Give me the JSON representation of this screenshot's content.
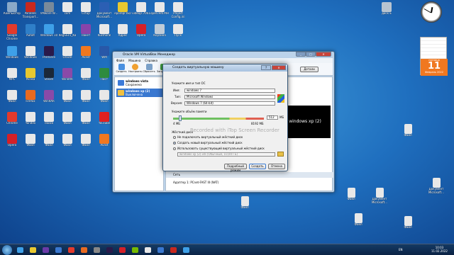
{
  "desktop_icons": [
    {
      "label": "Компьютер",
      "color": "#8aa8c8"
    },
    {
      "label": "Parallels Transport...",
      "color": "#c8281e"
    },
    {
      "label": "VMware W...",
      "color": "#7a8a9a"
    },
    {
      "label": "com",
      "color": "#e8e8e8"
    },
    {
      "label": "Cctup",
      "color": "#e8e8e8"
    },
    {
      "label": "Документ Microsoft...",
      "color": "#2b5fb4"
    },
    {
      "label": "eporepr.ISO",
      "color": "#e8c830"
    },
    {
      "label": "videojs.7061",
      "color": "#e8e8e8"
    },
    {
      "label": "open.Hiti.MH",
      "color": "#e8e8e8"
    },
    {
      "label": "Project Config.ini",
      "color": "#e8e8e8"
    },
    {
      "label": "Google Chrome",
      "color": "#e33a2c"
    },
    {
      "label": "AutoIt",
      "color": "#2f7fc8"
    },
    {
      "label": "Windows 10",
      "color": "#3ea0e8"
    },
    {
      "label": "RegSS15_Ka",
      "color": "#e8e8e8"
    },
    {
      "label": "Пакет",
      "color": "#8844aa"
    },
    {
      "label": "Kuzmoral",
      "color": "#e8e8e8"
    },
    {
      "label": "Адрес",
      "color": "#e8e8e8"
    },
    {
      "label": "Opera",
      "color": "#d42028"
    },
    {
      "label": "Корзина",
      "color": "#c0ccd8"
    },
    {
      "label": "Пуск",
      "color": "#e8e8e8"
    },
    {
      "label": "Windows",
      "color": "#3ea0e8"
    },
    {
      "label": "Windows",
      "color": "#e8e8e8"
    },
    {
      "label": "Premiere",
      "color": "#2a1a4a"
    },
    {
      "label": "Oracle",
      "color": "#e8e8e8"
    },
    {
      "label": "Avast",
      "color": "#f07820"
    },
    {
      "label": "WM",
      "color": "#2858a8"
    },
    {
      "label": "Текст",
      "color": "#e8e8e8"
    },
    {
      "label": "Paint",
      "color": "#e8e8e8"
    },
    {
      "label": "Nvidia",
      "color": "#76b900"
    },
    {
      "label": "Opera",
      "color": "#d42028"
    },
    {
      "label": "MPC",
      "color": "#e8e8e8"
    },
    {
      "label": "Picasa",
      "color": "#e8c830"
    },
    {
      "label": "Steam",
      "color": "#1b2838"
    },
    {
      "label": "WinRAR",
      "color": "#8a4aa8"
    },
    {
      "label": "Файл",
      "color": "#e8e8e8"
    },
    {
      "label": "Лист",
      "color": "#2e8b3e"
    },
    {
      "label": "Word",
      "color": "#2b5fb4"
    },
    {
      "label": "Skype",
      "color": "#00aff0"
    },
    {
      "label": "Opera",
      "color": "#d42028"
    },
    {
      "label": "Файл",
      "color": "#e8e8e8"
    },
    {
      "label": "Файл",
      "color": "#e8e8e8"
    },
    {
      "label": "Firefox",
      "color": "#e86a20"
    },
    {
      "label": "WinRAR",
      "color": "#8a4aa8"
    },
    {
      "label": "Файл",
      "color": "#e8e8e8"
    },
    {
      "label": "Файл",
      "color": "#e8e8e8"
    },
    {
      "label": "Файл",
      "color": "#e8e8e8"
    },
    {
      "label": "Файл",
      "color": "#e8e8e8"
    },
    {
      "label": "Архив",
      "color": "#8a4aa8"
    },
    {
      "label": "Файл",
      "color": "#e8e8e8"
    },
    {
      "label": "Файл",
      "color": "#e8e8e8"
    },
    {
      "label": "Chrome",
      "color": "#e33a2c"
    },
    {
      "label": "Yandex",
      "color": "#e8e8e8"
    },
    {
      "label": "Поиск",
      "color": "#e8e8e8"
    },
    {
      "label": "Файл",
      "color": "#e8e8e8"
    },
    {
      "label": "Файл",
      "color": "#e8e8e8"
    },
    {
      "label": "YouTube",
      "color": "#e02020"
    },
    {
      "label": "Файл",
      "color": "#e8e8e8"
    },
    {
      "label": "Файл",
      "color": "#e8e8e8"
    },
    {
      "label": "Файл",
      "color": "#e8e8e8"
    },
    {
      "label": "Файл",
      "color": "#e8e8e8"
    },
    {
      "label": "Opera",
      "color": "#d42028"
    },
    {
      "label": "Файл",
      "color": "#e8e8e8"
    },
    {
      "label": "Файл",
      "color": "#e8e8e8"
    },
    {
      "label": "Файл",
      "color": "#e8e8e8"
    },
    {
      "label": "Файл",
      "color": "#e8e8e8"
    },
    {
      "label": "Avast",
      "color": "#f07820"
    },
    {
      "label": "Файл",
      "color": "#e8e8e8"
    },
    {
      "label": "Файл",
      "color": "#e8e8e8"
    },
    {
      "label": "Файл",
      "color": "#e8e8e8"
    },
    {
      "label": "Файл",
      "color": "#e8e8e8"
    }
  ],
  "right_icons": [
    {
      "label": "Файл",
      "color": "#e8e8e8"
    },
    {
      "label": "Документ Microsoft...",
      "color": "#e8e8e8"
    },
    {
      "label": "Документ Microsoft...",
      "color": "#e8e8e8"
    },
    {
      "label": "Файл",
      "color": "#e8e8e8"
    },
    {
      "label": "Файл",
      "color": "#e8e8e8"
    },
    {
      "label": "Файл",
      "color": "#e8e8e8"
    },
    {
      "label": "Файл",
      "color": "#e8e8e8"
    }
  ],
  "disk_label": "диск E",
  "calendar": {
    "month": "Февраль 2022",
    "day": "11",
    "weekday": "пятница"
  },
  "vbox": {
    "title": "Oracle VM VirtualBox Менеджер",
    "menu": [
      "Файл",
      "Машина",
      "Справка"
    ],
    "toolbar": [
      "Создать",
      "Настроить",
      "Сбросить",
      "Запустить"
    ],
    "details_button": "Детали",
    "vms": [
      {
        "name": "windows vista",
        "state": "Сохранена",
        "color": "#3c7ad8"
      },
      {
        "name": "windows xp (2)",
        "state": "Выключена",
        "color": "#4a90e0"
      }
    ],
    "preview_text": "windows xp (2)",
    "network_section": "Сеть",
    "adapter": "Адаптер 1: PCnet-FAST III (NAT)"
  },
  "dialog": {
    "title": "Создать виртуальную машину",
    "section_name": "Укажите имя и тип ОС",
    "name_label": "Имя:",
    "name_value": "windows 7",
    "type_label": "Тип:",
    "type_value": "Microsoft Windows",
    "version_label": "Версия:",
    "version_value": "Windows 7 (64-bit)",
    "memory_section": "Укажите объём памяти",
    "memory_value": "512",
    "memory_unit": "МБ",
    "memory_min": "4 МБ",
    "memory_max": "8192 МБ",
    "memory_fraction": 0.06,
    "disk_section": "Жёсткий диск",
    "disk_options": [
      "Не подключать виртуальный жёсткий диск",
      "Создать новый виртуальный жёсткий диск",
      "Использовать существующий виртуальный жёсткий диск"
    ],
    "disk_selected": 1,
    "disk_file": "windows xp (2).vdi (Обычный, 10,00 ГБ)",
    "buttons": [
      "Подробный режим",
      "Создать",
      "Отмена"
    ]
  },
  "watermark": "Recorded with iTop Screen Recorder",
  "taskbar": {
    "lang": "EN",
    "time": "10:03",
    "date": "11.02.2022"
  }
}
